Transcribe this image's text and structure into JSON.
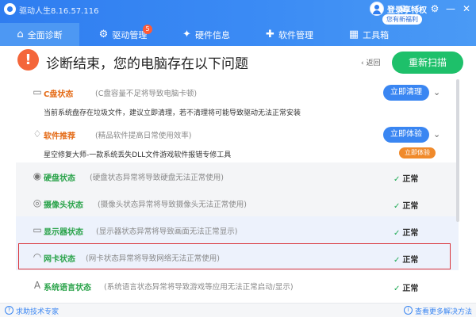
{
  "app": {
    "title": "驱动人生8.16.57.116"
  },
  "account": {
    "login": "登录享特权",
    "vip": "您有新福利"
  },
  "window_icons": [
    "♛",
    "☾",
    "⚙",
    "—",
    "✕"
  ],
  "tabs": [
    {
      "label": "全面诊断",
      "icon": "⌂"
    },
    {
      "label": "驱动管理",
      "icon": "⚙",
      "badge": "5"
    },
    {
      "label": "硬件信息",
      "icon": "✦"
    },
    {
      "label": "软件管理",
      "icon": "✚"
    },
    {
      "label": "工具箱",
      "icon": "▦"
    }
  ],
  "result": {
    "alert": "!",
    "title": "诊断结束，您的电脑存在以下问题",
    "back": "‹ 返回",
    "rescan": "重新扫描"
  },
  "rows": [
    {
      "name": "C盘状态",
      "desc": "(C盘容量不足将导致电脑卡顿)",
      "action": "立即清理",
      "icon": "▭",
      "detail": "当前系统盘存在垃圾文件，建议立即清理，若不清理将可能导致驱动无法正常安装"
    },
    {
      "name": "软件推荐",
      "desc": "(精品软件提高日常使用效率)",
      "action": "立即体验",
      "icon": "♢",
      "detail": "星空修复大师-一款系统丢失DLL文件游戏软件报错专修工具",
      "mini_action": "立即体验"
    },
    {
      "name": "硬盘状态",
      "desc": "(硬盘状态异常将导致硬盘无法正常使用)",
      "status": "正常",
      "icon": "◉"
    },
    {
      "name": "摄像头状态",
      "desc": "(摄像头状态异常将导致摄像头无法正常使用)",
      "status": "正常",
      "icon": "◎"
    },
    {
      "name": "显示器状态",
      "desc": "(显示器状态异常将导致画面无法正常显示)",
      "status": "正常",
      "icon": "▭"
    },
    {
      "name": "网卡状态",
      "desc": "(网卡状态异常将导致网络无法正常使用)",
      "status": "正常",
      "icon": "◠"
    },
    {
      "name": "系统语言状态",
      "desc": "(系统语言状态异常将导致游戏等应用无法正常启动/显示)",
      "status": "正常",
      "icon": "A"
    }
  ],
  "footer": {
    "help": "求助技术专家",
    "solutions": "查看更多解决方法"
  },
  "colors": {
    "header": "#2f7df0",
    "accent_green": "#1ec06a",
    "alert": "#f4663a",
    "highlight_frame": "#d9333a"
  }
}
